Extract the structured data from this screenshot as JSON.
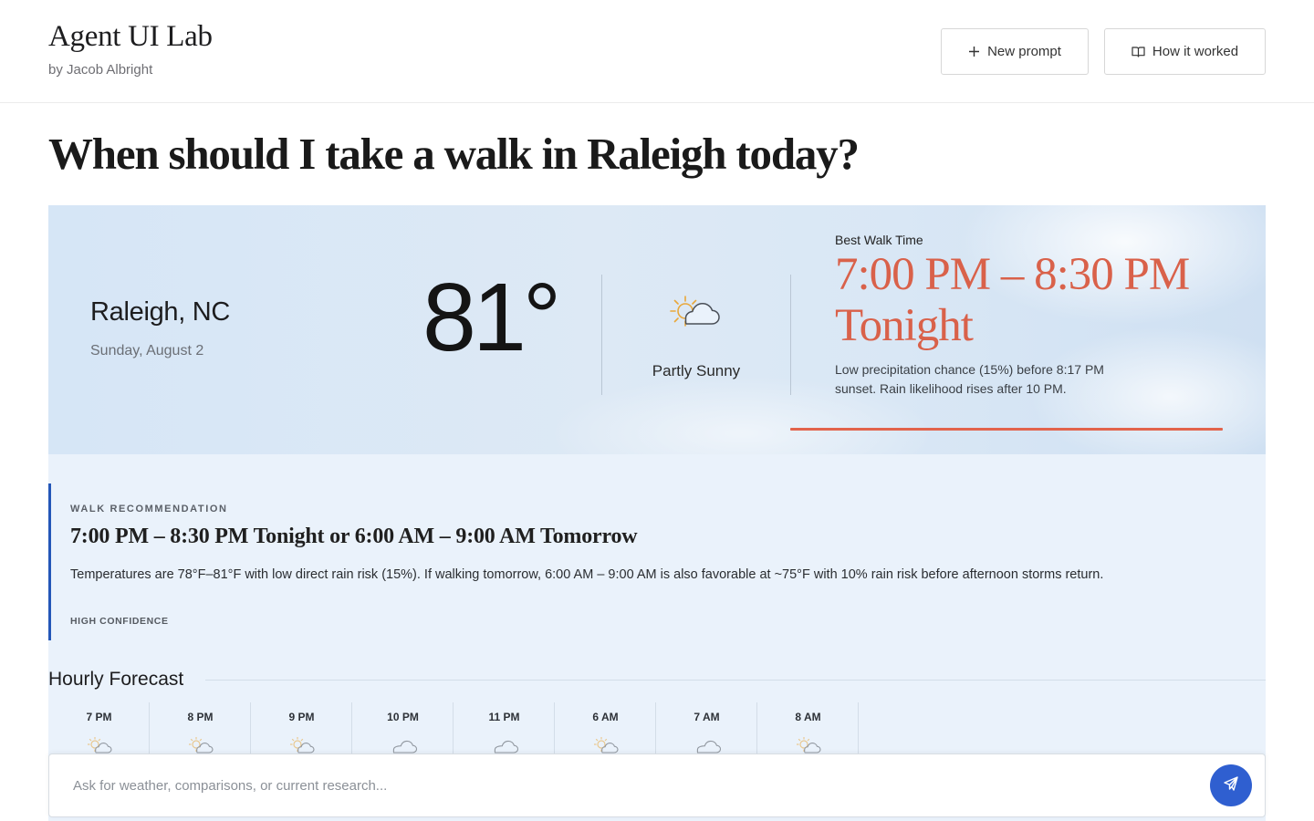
{
  "header": {
    "app_title": "Agent UI Lab",
    "byline": "by Jacob Albright",
    "new_prompt_label": "New prompt",
    "how_it_worked_label": "How it worked"
  },
  "question": "When should I take a walk in Raleigh today?",
  "weather": {
    "city": "Raleigh, NC",
    "date": "Sunday, August 2",
    "temperature": "81°",
    "condition": "Partly Sunny",
    "best_walk": {
      "label": "Best Walk Time",
      "time_range": "7:00 PM – 8:30 PM",
      "period": "Tonight",
      "note": "Low precipitation chance (15%) before 8:17 PM sunset. Rain likelihood rises after 10 PM."
    },
    "accent_color": "#e2634b"
  },
  "recommendation": {
    "label": "WALK RECOMMENDATION",
    "title": "7:00 PM – 8:30 PM Tonight or 6:00 AM – 9:00 AM Tomorrow",
    "body": "Temperatures are 78°F–81°F with low direct rain risk (15%). If walking tomorrow, 6:00 AM – 9:00 AM is also favorable at ~75°F with 10% rain risk before afternoon storms return.",
    "confidence": "HIGH CONFIDENCE",
    "bar_color": "#2457b8"
  },
  "hourly": {
    "title": "Hourly Forecast",
    "hours": [
      {
        "time": "7 PM",
        "icon": "partly-sunny-icon"
      },
      {
        "time": "8 PM",
        "icon": "partly-sunny-icon"
      },
      {
        "time": "9 PM",
        "icon": "partly-sunny-icon"
      },
      {
        "time": "10 PM",
        "icon": "cloud-icon"
      },
      {
        "time": "11 PM",
        "icon": "cloud-icon"
      },
      {
        "time": "6 AM",
        "icon": "partly-sunny-icon"
      },
      {
        "time": "7 AM",
        "icon": "cloud-icon"
      },
      {
        "time": "8 AM",
        "icon": "partly-sunny-icon"
      }
    ]
  },
  "composer": {
    "placeholder": "Ask for weather, comparisons, or current research...",
    "send_icon": "send-icon",
    "send_color": "#2f5fd0"
  }
}
